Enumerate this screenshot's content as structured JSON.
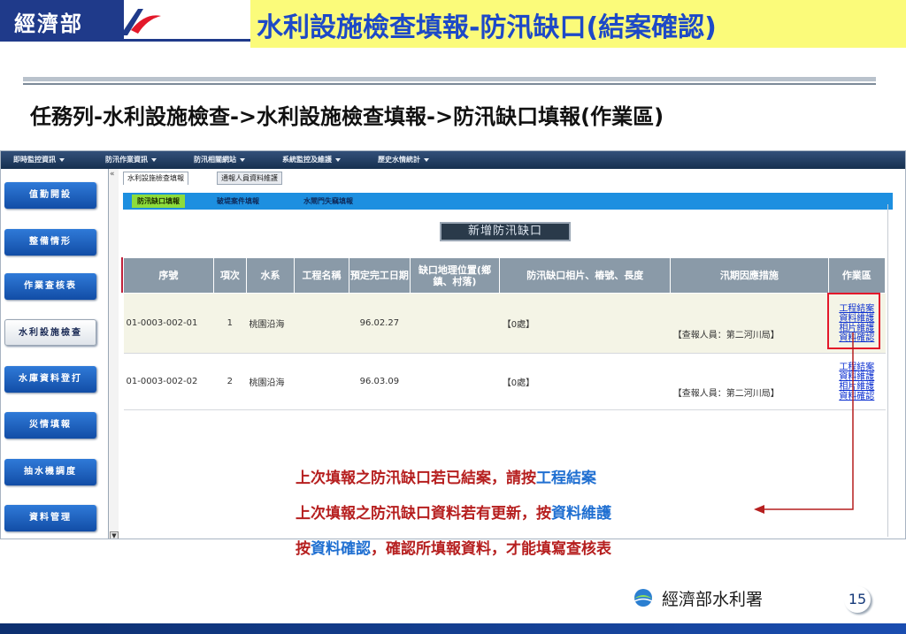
{
  "slide": {
    "ministry_label": "經濟部",
    "title": "水利設施檢查填報-防汛缺口(結案確認)",
    "breadcrumb": "任務列-水利設施檢查->水利設施檢查填報->防汛缺口填報(作業區)",
    "page_number": "15",
    "footer_logo_text": "經濟部水利署",
    "colors": {
      "title": "#1d49c7",
      "title_bg": "#fbfb7a",
      "note": "#b61f1f",
      "note_highlight": "#1f6fd1"
    }
  },
  "app": {
    "top_menu": [
      "即時監控資訊",
      "防汛作業資訊",
      "防汛相關網站",
      "系統監控及維護",
      "歷史水情統計"
    ],
    "sidebar": {
      "items": [
        "值勤開設",
        "整備情形",
        "作業查核表",
        "水利設施檢查",
        "水庫資料登打",
        "災情填報",
        "抽水機調度",
        "資料管理"
      ],
      "active": "水利設施檢查"
    },
    "tabs": [
      "水利設施檢查填報",
      "通報人員資料維護"
    ],
    "subtabs": [
      "防汛缺口填報",
      "破堤案件填報",
      "水閘門失竊填報"
    ],
    "new_button": "新增防汛缺口",
    "table": {
      "headers": [
        "序號",
        "項次",
        "水系",
        "工程名稱",
        "預定完工日期",
        "缺口地理位置(鄉鎮、村落)",
        "防汛缺口相片、樁號、長度",
        "汛期因應措施",
        "作業區"
      ],
      "rows": [
        {
          "serial": "01-0003-002-01",
          "index": "1",
          "water_system": "桃園沿海",
          "project": "",
          "date": "96.02.27",
          "location": "",
          "photos": "【0處】",
          "measures": "【查報人員：第二河川局】"
        },
        {
          "serial": "01-0003-002-02",
          "index": "2",
          "water_system": "桃園沿海",
          "project": "",
          "date": "96.03.09",
          "location": "",
          "photos": "【0處】",
          "measures": "【查報人員：第二河川局】"
        }
      ],
      "actions": [
        "工程結案",
        "資料維護",
        "相片維護",
        "資料確認"
      ]
    }
  },
  "notes": {
    "line1_prefix": "上次填報之防汛缺口若已結案，請按",
    "line1_highlight": "工程結案",
    "line2_prefix": "上次填報之防汛缺口資料若有更新，按",
    "line2_highlight": "資料維護",
    "line3_prefix": "按",
    "line3_highlight": "資料確認",
    "line3_suffix": "，確認所填報資料，才能填寫查核表"
  },
  "icons": [
    "ministry-swoosh-icon",
    "collapse-double-chevron-icon",
    "scroll-down-icon",
    "water-resources-logo-icon"
  ]
}
